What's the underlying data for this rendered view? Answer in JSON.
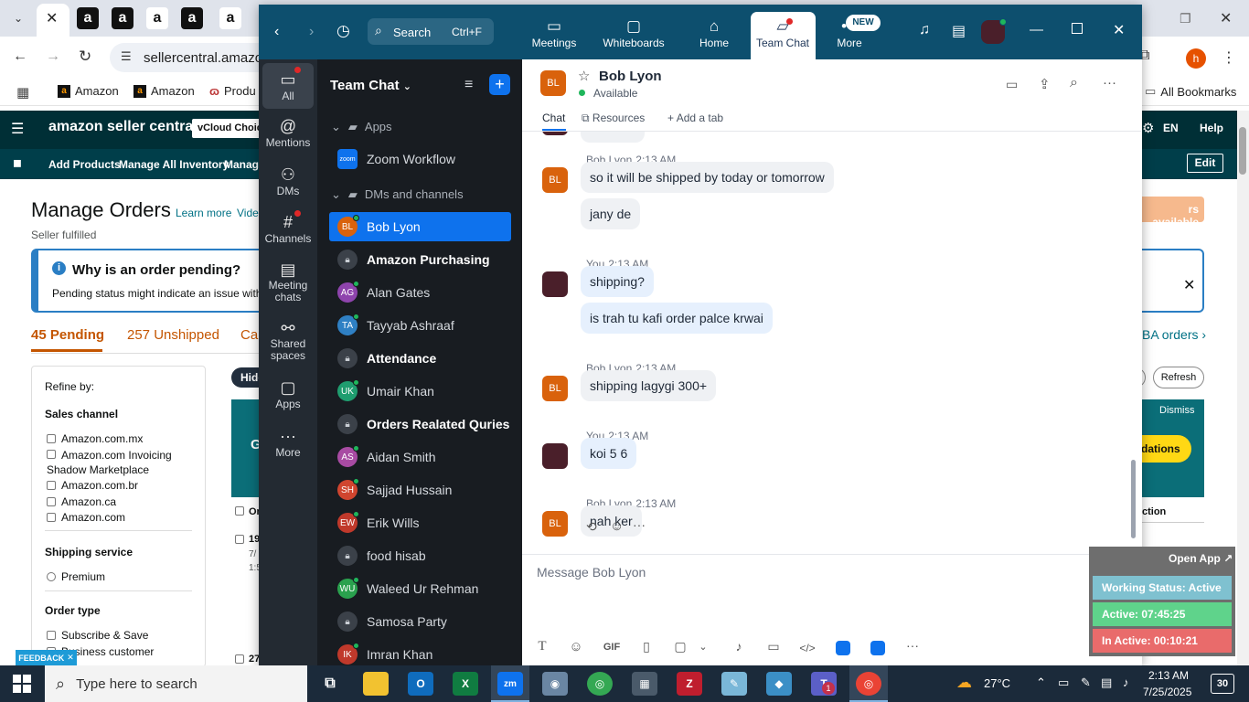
{
  "chrome": {
    "url": "sellercentral.amazon",
    "bookmarks": [
      "Amazon",
      "Amazon",
      "Produ"
    ],
    "all_bookmarks": "All Bookmarks",
    "profile_initial": "h"
  },
  "amazon": {
    "brand": "amazon seller central",
    "vcloud": "vCloud Choice",
    "lang": "EN",
    "help": "Help",
    "nav": [
      "Add Products",
      "Manage All Inventory",
      "Manage"
    ],
    "edit": "Edit",
    "page_title": "Manage Orders",
    "learn_more": "Learn more",
    "video": "Vide",
    "subtitle": "Seller fulfilled",
    "banner_title": "Why is an order pending?",
    "banner_text": "Pending status might indicate an issue with t",
    "tabs": {
      "pending": "45 Pending",
      "unshipped": "257 Unshipped",
      "canceled": "Can"
    },
    "refine": "Refine by:",
    "sales_channel": "Sales channel",
    "channels": [
      "Amazon.com.mx",
      "Amazon.com Invoicing Shadow Marketplace",
      "Amazon.com.br",
      "Amazon.ca",
      "Amazon.com"
    ],
    "shipping_service": "Shipping service",
    "premium": "Premium",
    "order_type": "Order type",
    "order_types": [
      "Subscribe & Save",
      "Business customer"
    ],
    "hide": "Hide",
    "refresh": "Refresh",
    "dismiss": "Dismiss",
    "fba": "BA orders",
    "available": "rs available",
    "dations": "dations",
    "ction": "ction",
    "feedback": "FEEDBACK",
    "or_col": "Or",
    "row1": "19",
    "row1_date": "7/",
    "row1_time": "1:5",
    "row2": "27",
    "g": "G"
  },
  "zoom": {
    "search": "Search",
    "search_shortcut": "Ctrl+F",
    "top_items": [
      {
        "label": "Meetings",
        "icon": "video-camera-icon"
      },
      {
        "label": "Whiteboards",
        "icon": "whiteboard-icon"
      },
      {
        "label": "Home",
        "icon": "home-icon"
      },
      {
        "label": "Team Chat",
        "icon": "chat-icon"
      },
      {
        "label": "More",
        "icon": "more-icon"
      }
    ],
    "new_badge": "NEW",
    "rail": [
      {
        "label": "All",
        "icon": "chat-bubble-icon"
      },
      {
        "label": "Mentions",
        "icon": "at-icon"
      },
      {
        "label": "DMs",
        "icon": "people-icon"
      },
      {
        "label": "Channels",
        "icon": "hash-icon"
      },
      {
        "label": "Meeting chats",
        "icon": "calendar-icon"
      },
      {
        "label": "Shared spaces",
        "icon": "share-icon"
      },
      {
        "label": "Apps",
        "icon": "apps-icon"
      },
      {
        "label": "More",
        "icon": "more-icon"
      }
    ],
    "panel_title": "Team Chat",
    "apps_header": "Apps",
    "zoom_workflow": "Zoom Workflow",
    "dms_header": "DMs and channels",
    "list": [
      {
        "label": "Bob Lyon",
        "initials": "BL",
        "color": "#d9620c",
        "type": "dm",
        "active": true
      },
      {
        "label": "Amazon Purchasing",
        "type": "lock",
        "bold": true
      },
      {
        "label": "Alan Gates",
        "initials": "AG",
        "color": "#8e44ad",
        "type": "dm"
      },
      {
        "label": "Tayyab Ashraaf",
        "initials": "TA",
        "color": "#2f80c4",
        "type": "dm"
      },
      {
        "label": "Attendance",
        "type": "lock",
        "bold": true
      },
      {
        "label": "Umair Khan",
        "initials": "UK",
        "color": "#1f9d6f",
        "type": "dm"
      },
      {
        "label": "Orders Realated Quries",
        "type": "lock",
        "bold": true
      },
      {
        "label": "Aidan Smith",
        "initials": "AS",
        "color": "#a84ba3",
        "type": "dm"
      },
      {
        "label": "Sajjad Hussain",
        "initials": "SH",
        "color": "#d0452f",
        "type": "dm"
      },
      {
        "label": "Erik Wills",
        "initials": "EW",
        "color": "#c0392b",
        "type": "dm"
      },
      {
        "label": "food hisab",
        "type": "lock"
      },
      {
        "label": "Waleed Ur Rehman",
        "initials": "WU",
        "color": "#2aa14e",
        "type": "dm"
      },
      {
        "label": "Samosa Party",
        "type": "lock"
      },
      {
        "label": "Imran Khan",
        "initials": "IK",
        "color": "#c0392b",
        "type": "dm"
      }
    ],
    "contact": {
      "name": "Bob Lyon",
      "initials": "BL",
      "status": "Available"
    },
    "tabs": [
      "Chat",
      "Resources",
      "Add a tab"
    ],
    "messages": [
      {
        "sender": "Bob Lyon",
        "time": "2:13 AM",
        "mine": false,
        "texts": [
          "so it will be shipped by today or tomorrow",
          "jany de"
        ]
      },
      {
        "sender": "You",
        "time": "2:13 AM",
        "mine": true,
        "texts": [
          "shipping?",
          "is trah tu kafi order palce krwai"
        ]
      },
      {
        "sender": "Bob Lyon",
        "time": "2:13 AM",
        "mine": false,
        "texts": [
          "shipping lagygi 300+"
        ]
      },
      {
        "sender": "You",
        "time": "2:13 AM",
        "mine": true,
        "texts": [
          "koi 5 6"
        ]
      },
      {
        "sender": "Bob Lyon",
        "time": "2:13 AM",
        "mine": false,
        "texts": [
          "nah ker"
        ]
      }
    ],
    "composer_placeholder": "Message Bob Lyon",
    "gif": "GIF"
  },
  "widget": {
    "open_app": "Open App ↗",
    "working_status": "Working Status: Active",
    "active": "Active: 07:45:25",
    "inactive": "In Active: 00:10:21"
  },
  "taskbar": {
    "search_placeholder": "Type here to search",
    "temperature": "27°C",
    "time": "2:13 AM",
    "date": "7/25/2025",
    "notification_count": "30",
    "teams_badge": "1"
  }
}
